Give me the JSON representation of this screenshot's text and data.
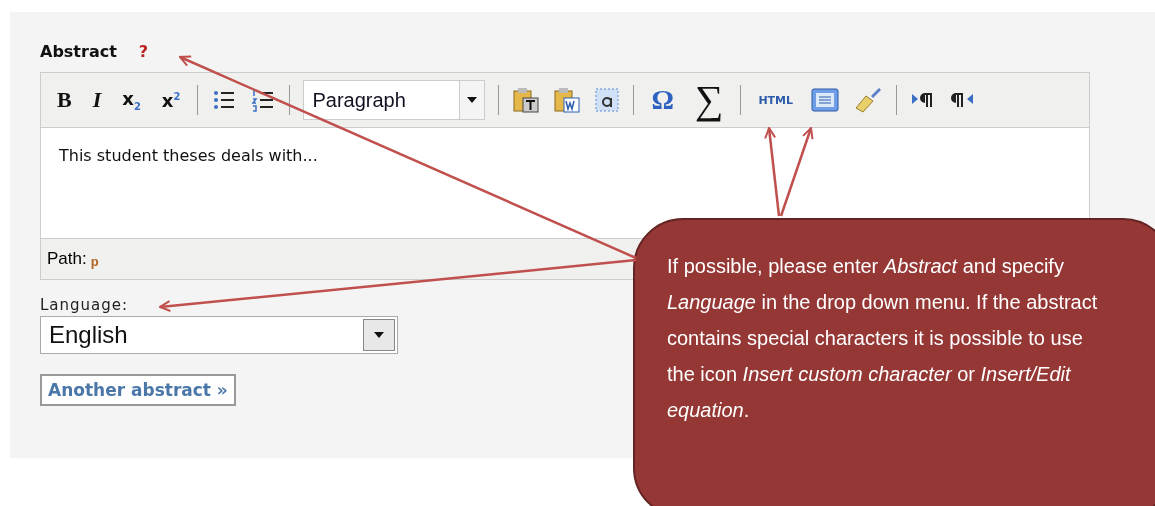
{
  "abstract_label": "Abstract",
  "help_mark": "?",
  "toolbar": {
    "bold": "B",
    "italic": "I",
    "subscript": "x$_{2}$",
    "superscript": "x$^{2}$",
    "format": "Paragraph",
    "omega": "Ω",
    "sigma": "∑",
    "html": "HTML"
  },
  "editor_text": "This student theses deals with...",
  "path_label": "Path:",
  "path_value": "p",
  "language_label": "Language:",
  "language_value": "English",
  "another_button": "Another abstract »",
  "callout": "If possible, please enter *Abstract* and specify *Language* in the drop down menu. If the abstract contains special characters it is possible to use the icon *Insert custom character* or *Insert/Edit equation*."
}
